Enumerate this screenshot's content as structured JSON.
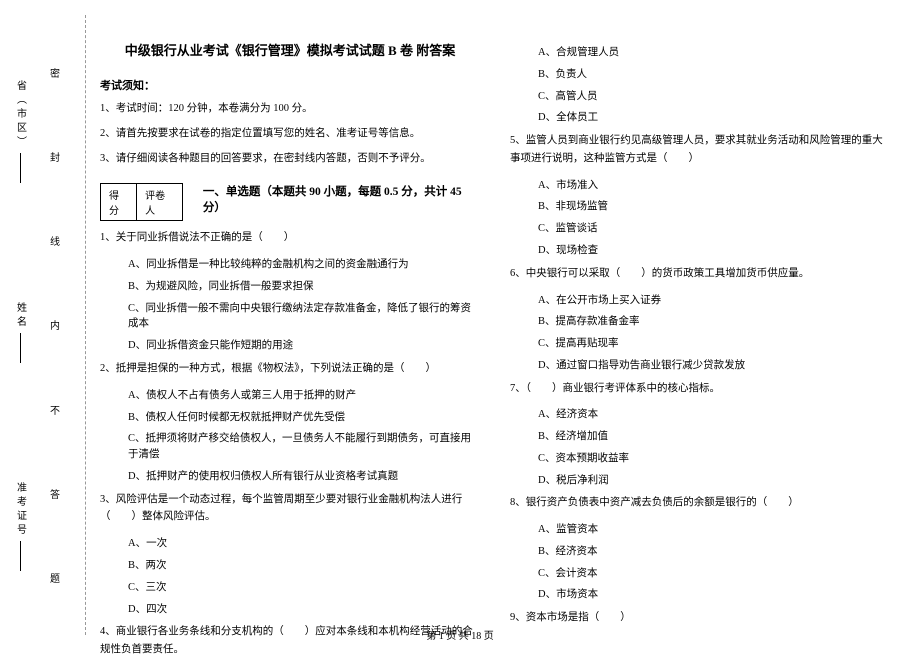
{
  "binding": {
    "labels": [
      "省（市区）",
      "姓名",
      "准考证号"
    ],
    "seal_chars": [
      "密",
      "封",
      "线",
      "内",
      "不",
      "答",
      "题"
    ]
  },
  "title": "中级银行从业考试《银行管理》模拟考试试题 B 卷  附答案",
  "notice_label": "考试须知：",
  "instructions": [
    "1、考试时间：120 分钟，本卷满分为 100 分。",
    "2、请首先按要求在试卷的指定位置填写您的姓名、准考证号等信息。",
    "3、请仔细阅读各种题目的回答要求，在密封线内答题，否则不予评分。"
  ],
  "score_box": {
    "score_label": "得分",
    "grader_label": "评卷人"
  },
  "part_heading": "一、单选题（本题共 90 小题，每题 0.5 分，共计 45 分）",
  "questions_left": [
    {
      "stem": "1、关于同业拆借说法不正确的是（　　）",
      "options": [
        "A、同业拆借是一种比较纯粹的金融机构之间的资金融通行为",
        "B、为规避风险，同业拆借一般要求担保",
        "C、同业拆借一般不需向中央银行缴纳法定存款准备金，降低了银行的筹资成本",
        "D、同业拆借资金只能作短期的用途"
      ]
    },
    {
      "stem": "2、抵押是担保的一种方式，根据《物权法》，下列说法正确的是（　　）",
      "options": [
        "A、债权人不占有债务人或第三人用于抵押的财产",
        "B、债权人任何时候都无权就抵押财产优先受偿",
        "C、抵押须将财产移交给债权人，一旦债务人不能履行到期债务，可直接用于清偿",
        "D、抵押财产的使用权归债权人所有银行从业资格考试真题"
      ]
    },
    {
      "stem": "3、风险评估是一个动态过程，每个监管周期至少要对银行业金融机构法人进行（　　）整体风险评估。",
      "options": [
        "A、一次",
        "B、两次",
        "C、三次",
        "D、四次"
      ]
    },
    {
      "stem": "4、商业银行各业务条线和分支机构的（　　）应对本条线和本机构经营活动的合规性负首要责任。",
      "options": []
    }
  ],
  "questions_right": [
    {
      "stem": "",
      "options": [
        "A、合规管理人员",
        "B、负责人",
        "C、高管人员",
        "D、全体员工"
      ]
    },
    {
      "stem": "5、监管人员到商业银行约见高级管理人员，要求其就业务活动和风险管理的重大事项进行说明，这种监管方式是（　　）",
      "options": [
        "A、市场准入",
        "B、非现场监管",
        "C、监管谈话",
        "D、现场检查"
      ]
    },
    {
      "stem": "6、中央银行可以采取（　　）的货币政策工具增加货币供应量。",
      "options": [
        "A、在公开市场上买入证券",
        "B、提高存款准备金率",
        "C、提高再贴现率",
        "D、通过窗口指导劝告商业银行减少贷款发放"
      ]
    },
    {
      "stem": "7、（　　）商业银行考评体系中的核心指标。",
      "options": [
        "A、经济资本",
        "B、经济增加值",
        "C、资本预期收益率",
        "D、税后净利润"
      ]
    },
    {
      "stem": "8、银行资产负债表中资产减去负债后的余额是银行的（　　）",
      "options": [
        "A、监管资本",
        "B、经济资本",
        "C、会计资本",
        "D、市场资本"
      ]
    },
    {
      "stem": "9、资本市场是指（　　）",
      "options": []
    }
  ],
  "footer": "第 1 页 共 18 页"
}
